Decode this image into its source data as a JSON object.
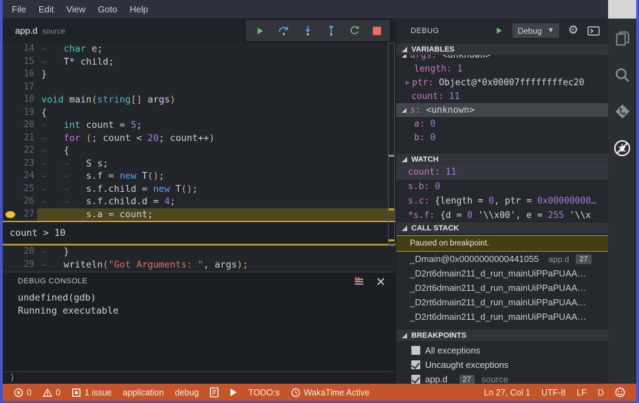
{
  "menu": [
    "File",
    "Edit",
    "View",
    "Goto",
    "Help"
  ],
  "tab": {
    "name": "app.d",
    "hint": "source"
  },
  "toolbar": {
    "icons": [
      "continue",
      "step-over",
      "step-into",
      "step-out",
      "restart",
      "stop"
    ]
  },
  "editor": {
    "breakpoint_line": 27,
    "condition_widget": {
      "text": "count > 10"
    },
    "lines": [
      {
        "n": 14,
        "ind": 1,
        "toks": [
          [
            "char",
            "type"
          ],
          [
            " e;",
            "plain"
          ]
        ]
      },
      {
        "n": 15,
        "ind": 1,
        "toks": [
          [
            "T* child;",
            "plain"
          ]
        ]
      },
      {
        "n": 16,
        "ind": 0,
        "toks": [
          [
            "}",
            "plain"
          ]
        ]
      },
      {
        "n": 17,
        "ind": 0,
        "toks": []
      },
      {
        "n": 18,
        "ind": 0,
        "toks": [
          [
            "void",
            "type"
          ],
          [
            " main",
            "plain"
          ],
          [
            "(",
            "punct"
          ],
          [
            "string",
            "type2"
          ],
          [
            "[]",
            "punct"
          ],
          [
            " args",
            "plain"
          ],
          [
            ")",
            "punct"
          ]
        ]
      },
      {
        "n": 19,
        "ind": 0,
        "toks": [
          [
            "{",
            "plain"
          ]
        ]
      },
      {
        "n": 20,
        "ind": 1,
        "toks": [
          [
            "int",
            "type"
          ],
          [
            " count = ",
            "plain"
          ],
          [
            "5",
            "num"
          ],
          [
            ";",
            "plain"
          ]
        ]
      },
      {
        "n": 21,
        "ind": 1,
        "toks": [
          [
            "for",
            "kw"
          ],
          [
            " ",
            "plain"
          ],
          [
            "(",
            "punct"
          ],
          [
            "; count < ",
            "plain"
          ],
          [
            "20",
            "num"
          ],
          [
            "; count++",
            "plain"
          ],
          [
            ")",
            "punct"
          ]
        ]
      },
      {
        "n": 22,
        "ind": 1,
        "toks": [
          [
            "{",
            "plain"
          ]
        ]
      },
      {
        "n": 23,
        "ind": 2,
        "toks": [
          [
            "S s;",
            "plain"
          ]
        ]
      },
      {
        "n": 24,
        "ind": 2,
        "toks": [
          [
            "s.f = ",
            "plain"
          ],
          [
            "new",
            "kw2"
          ],
          [
            " T",
            "plain"
          ],
          [
            "()",
            "punct"
          ],
          [
            ";",
            "plain"
          ]
        ]
      },
      {
        "n": 25,
        "ind": 2,
        "toks": [
          [
            "s.f.child = ",
            "plain"
          ],
          [
            "new",
            "kw2"
          ],
          [
            " T",
            "plain"
          ],
          [
            "()",
            "punct"
          ],
          [
            ";",
            "plain"
          ]
        ]
      },
      {
        "n": 26,
        "ind": 2,
        "toks": [
          [
            "s.f.child.d = ",
            "plain"
          ],
          [
            "4",
            "num"
          ],
          [
            ";",
            "plain"
          ]
        ]
      },
      {
        "n": 27,
        "ind": 2,
        "toks": [
          [
            "s.a = count;",
            "plain"
          ]
        ]
      },
      {
        "n": 28,
        "ind": 1,
        "toks": [
          [
            "}",
            "plain"
          ]
        ]
      },
      {
        "n": 29,
        "ind": 1,
        "toks": [
          [
            "writeln",
            "plain"
          ],
          [
            "(",
            "punct"
          ],
          [
            "\"Got Arguments: \"",
            "str"
          ],
          [
            ", args",
            "plain"
          ],
          [
            ");",
            "punct"
          ]
        ]
      }
    ]
  },
  "console": {
    "title": "DEBUG CONSOLE",
    "lines": [
      "undefined(gdb)",
      "Running executable"
    ],
    "prompt": "⟩"
  },
  "debug_panel": {
    "title": "DEBUG",
    "launch_config": "Debug",
    "sections": {
      "variables": "VARIABLES",
      "watch": "WATCH",
      "call_stack": "CALL STACK",
      "breakpoints": "BREAKPOINTS"
    },
    "variables": [
      {
        "name": "args",
        "value": "<unknown>",
        "vcls": "plain",
        "expanded": true,
        "clipped": true,
        "lvl": 0
      },
      {
        "name": "length",
        "value": "1",
        "vcls": "num",
        "lvl": 1
      },
      {
        "name": "ptr",
        "value": "Object@*0x00007ffffffffec20",
        "vcls": "plain",
        "collapsed": true,
        "lvl": 1
      },
      {
        "name": "count",
        "value": "11",
        "vcls": "num",
        "lvl": 0,
        "leaf": true
      },
      {
        "name": "s",
        "value": "<unknown>",
        "vcls": "plain",
        "expanded": true,
        "selected": true,
        "lvl": 0
      },
      {
        "name": "a",
        "value": "0",
        "vcls": "num",
        "lvl": 1
      },
      {
        "name": "b",
        "value": "0",
        "vcls": "num",
        "lvl": 1
      }
    ],
    "watch": [
      {
        "name": "count",
        "val": [
          [
            "11",
            "num"
          ]
        ],
        "highlighted": true
      },
      {
        "name": "s.b",
        "val": [
          [
            "0",
            "num"
          ]
        ]
      },
      {
        "name": "s.c",
        "val": [
          [
            "{length = ",
            "plain"
          ],
          [
            "0",
            "num"
          ],
          [
            ", ptr = ",
            "plain"
          ],
          [
            "0x00000000…",
            "num"
          ]
        ]
      },
      {
        "name": "*s.f",
        "val": [
          [
            "{d = ",
            "plain"
          ],
          [
            "0",
            "num"
          ],
          [
            " '\\\\x00', e = ",
            "plain"
          ],
          [
            "255",
            "num"
          ],
          [
            " '\\\\x",
            "plain"
          ]
        ]
      }
    ],
    "call_stack": {
      "status": "Paused on breakpoint.",
      "frames": [
        {
          "fn": "_Dmain@0x0000000000441055",
          "file": "app.d",
          "line": "27"
        },
        {
          "fn": "_D2rt6dmain211_d_run_mainUiPPaPUAA…"
        },
        {
          "fn": "_D2rt6dmain211_d_run_mainUiPPaPUAA…"
        },
        {
          "fn": "_D2rt6dmain211_d_run_mainUiPPaPUAA…"
        },
        {
          "fn": "_D2rt6dmain211_d_run_mainUiPPaPUAA…"
        }
      ]
    },
    "breakpoints": [
      {
        "checked": false,
        "label": "All exceptions"
      },
      {
        "checked": true,
        "label": "Uncaught exceptions"
      },
      {
        "checked": true,
        "label": "app.d",
        "badge": "27",
        "hint": "source"
      }
    ]
  },
  "status_bar": {
    "left": [
      {
        "icon": "error",
        "text": "0"
      },
      {
        "icon": "warning",
        "text": "0"
      },
      {
        "icon": "issues",
        "text": "1 issue"
      },
      {
        "text": "application"
      },
      {
        "text": "debug"
      },
      {
        "icon": "log"
      },
      {
        "icon": "run"
      },
      {
        "text": "TODO:s"
      },
      {
        "icon": "clock",
        "text": "WakaTime Active"
      }
    ],
    "right": [
      {
        "text": "Ln 27, Col 1"
      },
      {
        "text": "UTF-8"
      },
      {
        "text": "LF"
      },
      {
        "text": "D"
      },
      {
        "icon": "smiley"
      }
    ]
  },
  "activity_bar": [
    "files",
    "search",
    "source-control",
    "debug-off"
  ],
  "colors": {
    "window_border": "#4853c6",
    "status_bar": "#c4552a",
    "breakpoint": "#eec32d",
    "paused_banner": "#453e14",
    "current_line": "#4c471d"
  }
}
